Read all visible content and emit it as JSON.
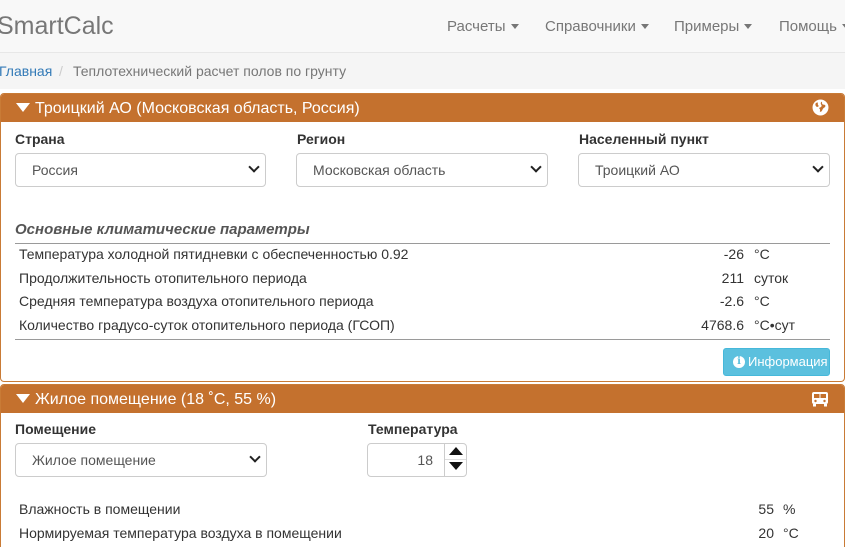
{
  "navbar": {
    "brand": "SmartCalc",
    "menu": [
      {
        "label": "Расчеты"
      },
      {
        "label": "Справочники"
      },
      {
        "label": "Примеры"
      },
      {
        "label": "Помощь"
      }
    ]
  },
  "breadcrumb": {
    "home": "Главная",
    "separator": "/",
    "current": "Теплотехнический расчет полов по грунту"
  },
  "location_panel": {
    "title": "Троицкий АО (Московская область, Россия)",
    "icon": "globe-icon",
    "country_label": "Страна",
    "country_value": "Россия",
    "region_label": "Регион",
    "region_value": "Московская область",
    "city_label": "Населенный пункт",
    "city_value": "Троицкий АО",
    "climate_title": "Основные климатические параметры",
    "climate_rows": [
      {
        "label": "Температура холодной пятидневки с обеспеченностью 0.92",
        "value": "-26",
        "unit": "°C"
      },
      {
        "label": "Продолжительность отопительного периода",
        "value": "211",
        "unit": "суток"
      },
      {
        "label": "Средняя температура воздуха отопительного периода",
        "value": "-2.6",
        "unit": "°C"
      },
      {
        "label": "Количество градусо-суток отопительного периода (ГСОП)",
        "value": "4768.6",
        "unit": "°C•сут"
      }
    ],
    "info_button": "Информация",
    "accent_color": "#c4712e",
    "info_color": "#5bc0de"
  },
  "room_panel": {
    "title": "Жилое помещение (18 ˚C, 55 %)",
    "icon": "bus-icon",
    "room_label": "Помещение",
    "room_value": "Жилое помещение",
    "temp_label": "Температура",
    "temp_value": "18",
    "rows": [
      {
        "label": "Влажность в помещении",
        "value": "55",
        "unit": "%"
      },
      {
        "label": "Нормируемая температура воздуха в помещении",
        "value": "20",
        "unit": "°C"
      }
    ]
  }
}
